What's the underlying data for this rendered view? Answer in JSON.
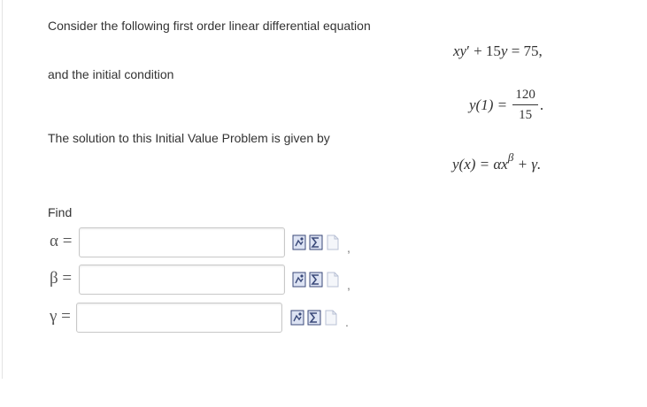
{
  "problem": {
    "intro": "Consider the following first order linear differential equation",
    "initial_condition_label": "and the initial condition",
    "solution_label": "The solution to this Initial Value Problem is given by",
    "find_label": "Find"
  },
  "equations": {
    "ode": {
      "lhs_a": "xy",
      "prime": "′",
      "plus_term": " + 15",
      "y": "y",
      "rhs": " = 75,"
    },
    "ic": {
      "lhs": "y(1) =",
      "numerator": "120",
      "denominator": "15",
      "end": "."
    },
    "solution": {
      "lhs": "y(x) = αx",
      "exponent": "β",
      "rest": " + γ."
    }
  },
  "answers": [
    {
      "symbol": "α =",
      "value": "",
      "separator": ","
    },
    {
      "symbol": "β =",
      "value": "",
      "separator": ","
    },
    {
      "symbol": "γ =",
      "value": "",
      "separator": "."
    }
  ],
  "icons": {
    "preview": "preview-icon",
    "equation_editor": "equation-editor-icon",
    "disabled": "disabled-doc-icon"
  }
}
